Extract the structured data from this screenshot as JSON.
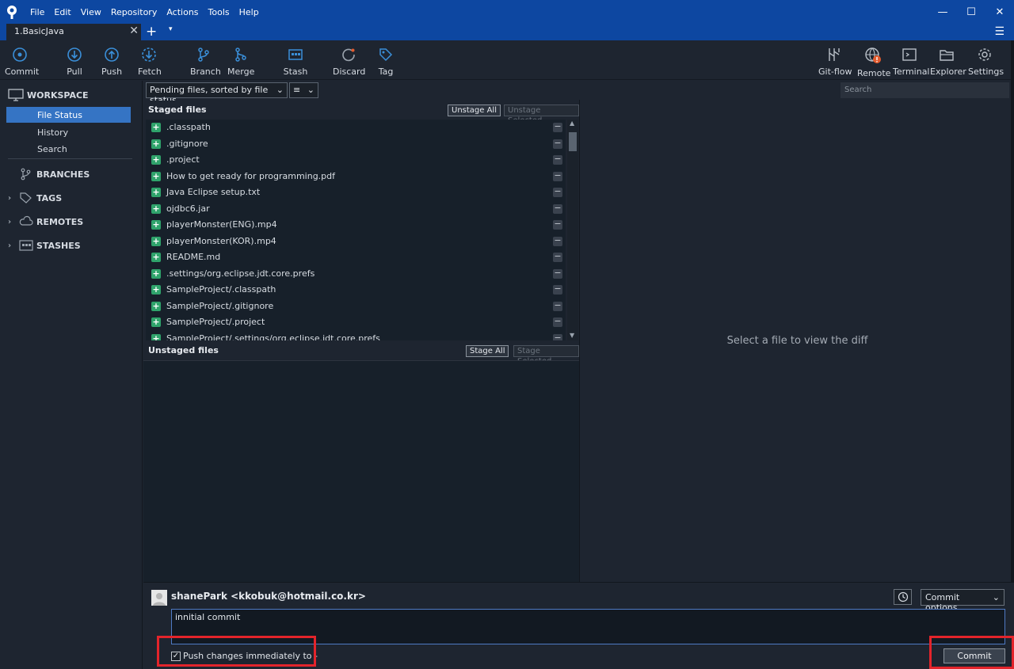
{
  "menu": [
    "File",
    "Edit",
    "View",
    "Repository",
    "Actions",
    "Tools",
    "Help"
  ],
  "tab": {
    "label": "1.BasicJava",
    "close": "✕",
    "add": "+",
    "dropdown": "▾"
  },
  "window_controls": {
    "minimize": "—",
    "maximize": "☐",
    "close": "✕"
  },
  "toolbar": {
    "commit": "Commit",
    "pull": "Pull",
    "push": "Push",
    "fetch": "Fetch",
    "branch": "Branch",
    "merge": "Merge",
    "stash": "Stash",
    "discard": "Discard",
    "tag": "Tag",
    "gitflow": "Git-flow",
    "remote": "Remote",
    "terminal": "Terminal",
    "explorer": "Explorer",
    "settings": "Settings"
  },
  "sidebar": {
    "workspace": "WORKSPACE",
    "items": [
      "File Status",
      "History",
      "Search"
    ],
    "branches": "BRANCHES",
    "tags": "TAGS",
    "remotes": "REMOTES",
    "stashes": "STASHES"
  },
  "filter": {
    "sort_label": "Pending files, sorted by file status",
    "view_icon": "≡",
    "search_placeholder": "Search"
  },
  "staged": {
    "title": "Staged files",
    "unstage_all": "Unstage All",
    "unstage_selected": "Unstage Selected",
    "files": [
      ".classpath",
      ".gitignore",
      ".project",
      "How to get ready for programming.pdf",
      "Java Eclipse setup.txt",
      "ojdbc6.jar",
      "playerMonster(ENG).mp4",
      "playerMonster(KOR).mp4",
      "README.md",
      ".settings/org.eclipse.jdt.core.prefs",
      "SampleProject/.classpath",
      "SampleProject/.gitignore",
      "SampleProject/.project",
      "SampleProject/.settings/org.eclipse.jdt.core.prefs"
    ]
  },
  "unstaged": {
    "title": "Unstaged files",
    "stage_all": "Stage All",
    "stage_selected": "Stage Selected"
  },
  "diff": {
    "placeholder": "Select a file to view the diff"
  },
  "commit": {
    "author": "shanePark <kkobuk@hotmail.co.kr>",
    "options": "Commit options...",
    "message": "innitial commit",
    "push_label": "Push changes immediately to -",
    "push_checked": "✓",
    "button": "Commit"
  }
}
